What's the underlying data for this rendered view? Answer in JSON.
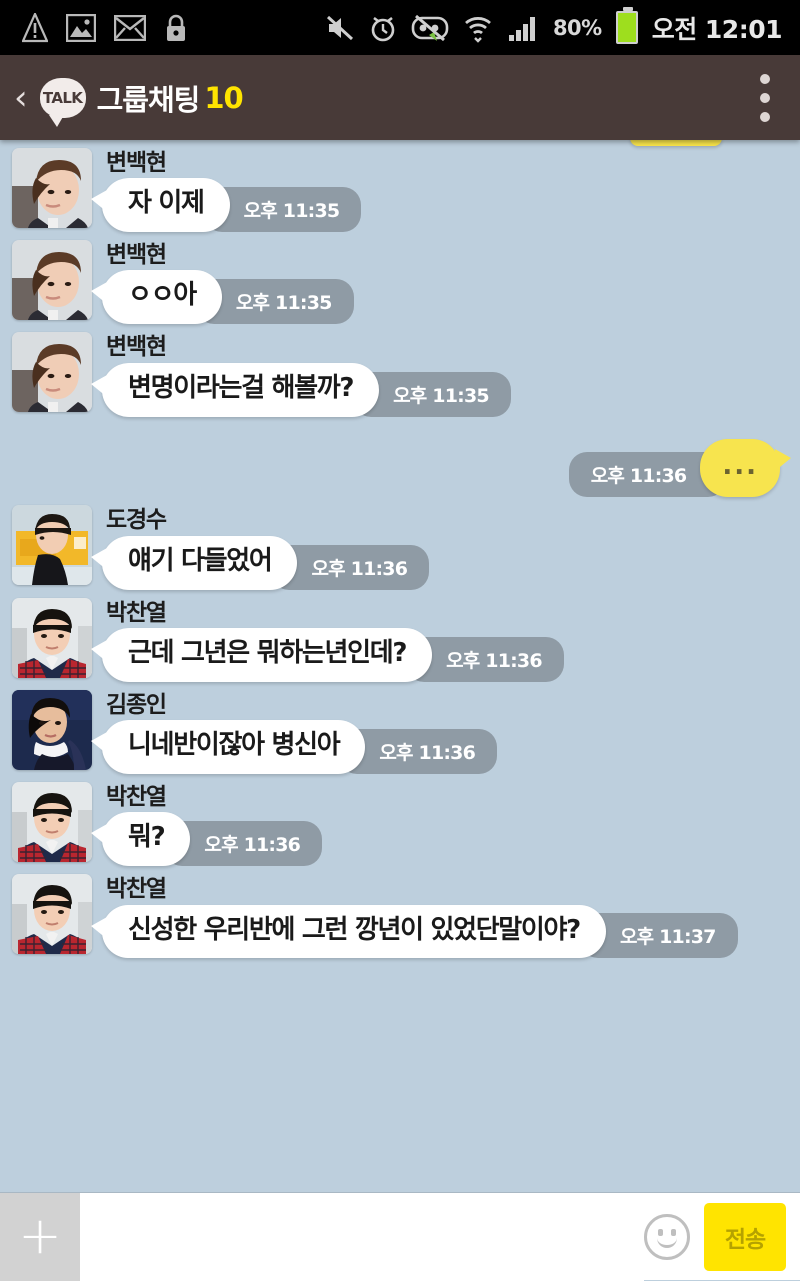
{
  "statusbar": {
    "icons_left": [
      "warning-icon",
      "image-icon",
      "mail-icon",
      "lock-icon"
    ],
    "icons_right": [
      "mute-icon",
      "alarm-icon",
      "sync-disabled-icon",
      "wifi-icon",
      "signal-icon"
    ],
    "battery_percent": "80%",
    "clock": "오전 12:01"
  },
  "titlebar": {
    "back_label": "‹",
    "logo_text": "TALK",
    "title": "그룹채팅",
    "count": "10",
    "menu_name": "overflow-menu"
  },
  "chat": {
    "messages": [
      {
        "sender": "변백현",
        "avatar": "baekhyun",
        "text": "자 이제",
        "time": "오후 11:35",
        "side": "in"
      },
      {
        "sender": "변백현",
        "avatar": "baekhyun",
        "text": "ㅇㅇ아",
        "time": "오후 11:35",
        "side": "in"
      },
      {
        "sender": "변백현",
        "avatar": "baekhyun",
        "text": "변명이라는걸 해볼까?",
        "time": "오후 11:35",
        "side": "in"
      },
      {
        "sender": "",
        "avatar": "",
        "text": "...",
        "time": "오후 11:36",
        "side": "out"
      },
      {
        "sender": "도경수",
        "avatar": "kyungsoo",
        "text": "얘기 다들었어",
        "time": "오후 11:36",
        "side": "in"
      },
      {
        "sender": "박찬열",
        "avatar": "chanyeol",
        "text": "근데 그년은 뭐하는년인데?",
        "time": "오후 11:36",
        "side": "in"
      },
      {
        "sender": "김종인",
        "avatar": "jongin",
        "text": "니네반이잖아 병신아",
        "time": "오후 11:36",
        "side": "in"
      },
      {
        "sender": "박찬열",
        "avatar": "chanyeol",
        "text": "뭐?",
        "time": "오후 11:36",
        "side": "in"
      },
      {
        "sender": "박찬열",
        "avatar": "chanyeol",
        "text": "신성한 우리반에 그런 깡년이 있었단말이야?",
        "time": "오후 11:37",
        "side": "in"
      }
    ]
  },
  "inputbar": {
    "plus_label": "+",
    "input_value": "",
    "input_placeholder": "",
    "emoji_name": "emoji-icon",
    "send_label": "전송"
  },
  "colors": {
    "titlebar": "#483a38",
    "chat_background": "#bdcfdd",
    "incoming_bubble": "#ffffff",
    "outgoing_bubble": "#f7e44e",
    "time_pill": "#8f9ba5",
    "accent_yellow": "#ffe400",
    "battery_green": "#9ede1e"
  }
}
